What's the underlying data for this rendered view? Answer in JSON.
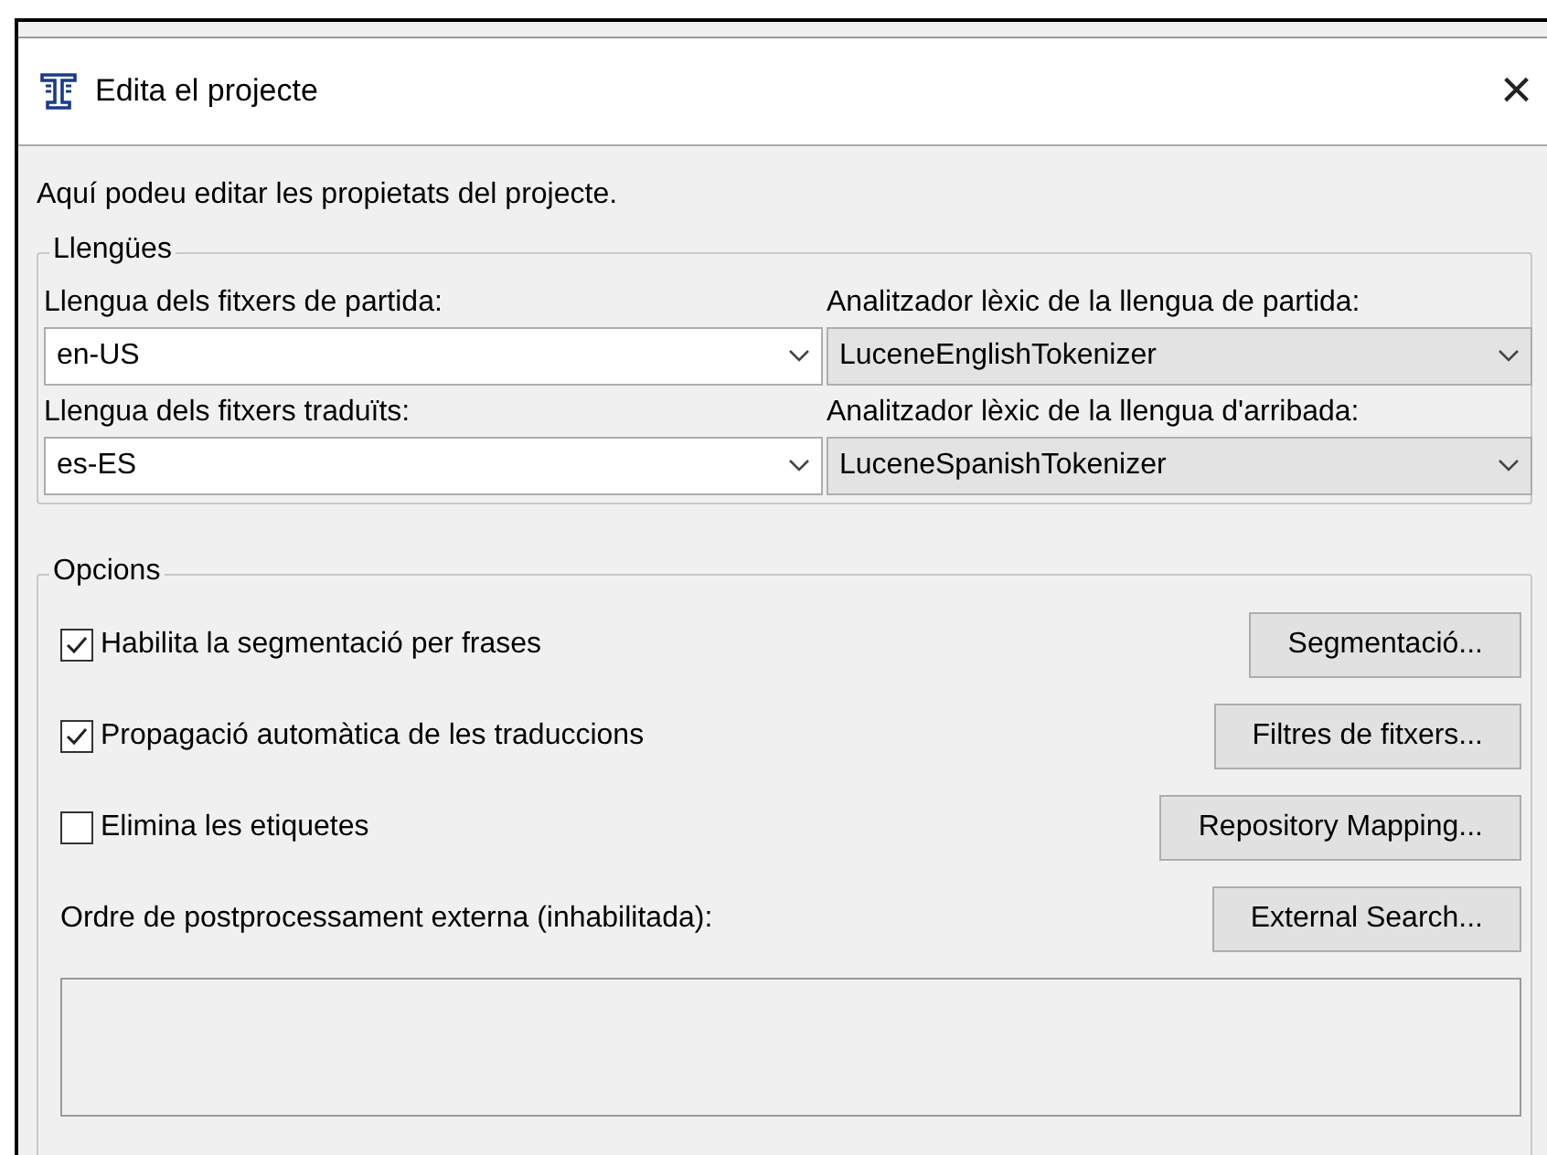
{
  "window": {
    "title": "Edita el projecte",
    "close": "×"
  },
  "intro": "Aquí podeu editar les propietats del projecte.",
  "languages": {
    "title": "Llengües",
    "fields": [
      {
        "label": "Llengua dels fitxers de partida:",
        "value": "en-US",
        "kind": "editable"
      },
      {
        "label": "Analitzador lèxic de la llengua de partida:",
        "value": "LuceneEnglishTokenizer",
        "kind": "readonly"
      },
      {
        "label": "Llengua dels fitxers traduïts:",
        "value": "es-ES",
        "kind": "editable"
      },
      {
        "label": "Analitzador lèxic de la llengua d'arribada:",
        "value": "LuceneSpanishTokenizer",
        "kind": "readonly"
      }
    ]
  },
  "options": {
    "title": "Opcions",
    "rows": [
      {
        "label": "Habilita la segmentació per frases",
        "checked": true,
        "button": "Segmentació..."
      },
      {
        "label": "Propagació automàtica de les traduccions",
        "checked": true,
        "button": "Filtres de fitxers..."
      },
      {
        "label": "Elimina les etiquetes",
        "checked": false,
        "button": "Repository Mapping..."
      }
    ],
    "command": {
      "label": "Ordre de postprocessament externa (inhabilitada):",
      "button": "External Search...",
      "disabled": true
    }
  }
}
